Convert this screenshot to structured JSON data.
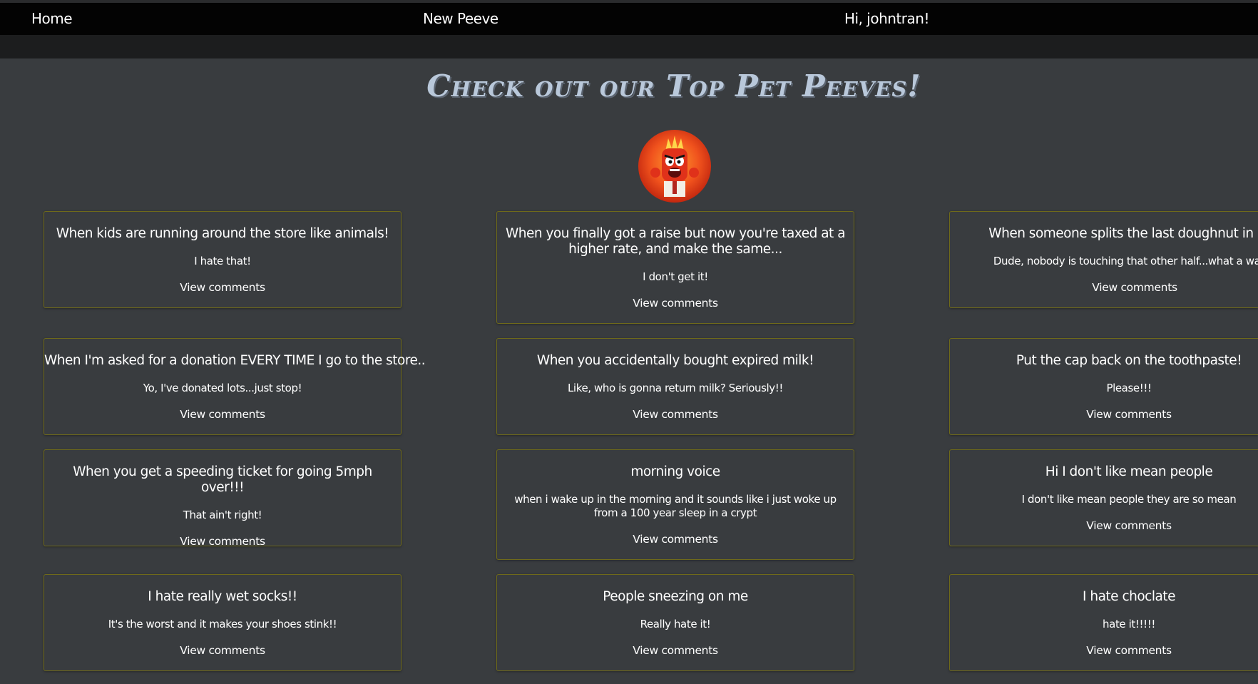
{
  "nav": {
    "home": "Home",
    "new_peeve": "New Peeve",
    "greeting": "Hi, johntran!"
  },
  "headline": "Check out our Top Pet Peeves!",
  "avatar_icon": "angry-character-icon",
  "accent_color": "#6f6a1a",
  "view_comments_label": "View comments",
  "cards": [
    {
      "title": "When kids are running around the store like animals!",
      "body": "I hate that!",
      "link": "View comments"
    },
    {
      "title": "When you finally got a raise but now you're taxed at a higher rate, and make the same...",
      "body": "I don't get it!",
      "link": "View comments"
    },
    {
      "title": "When someone splits the last doughnut in half",
      "body": "Dude, nobody is touching that other half...what a waste",
      "link": "View comments"
    },
    {
      "title": "When I'm asked for a donation EVERY TIME I go to the store..",
      "body": "Yo, I've donated lots...just stop!",
      "link": "View comments"
    },
    {
      "title": "When you accidentally bought expired milk!",
      "body": "Like, who is gonna return milk? Seriously!!",
      "link": "View comments"
    },
    {
      "title": "Put the cap back on the toothpaste!",
      "body": "Please!!!",
      "link": "View comments"
    },
    {
      "title": "When you get a speeding ticket for going 5mph over!!!",
      "body": "That ain't right!",
      "link": "View comments"
    },
    {
      "title": "morning voice",
      "body": "when i wake up in the morning and it sounds like i just woke up from a 100 year sleep in a crypt",
      "link": "View comments"
    },
    {
      "title": "Hi I don't like mean people",
      "body": "I don't like mean people they are so mean",
      "link": "View comments"
    },
    {
      "title": "I hate really wet socks!!",
      "body": "It's the worst and it makes your shoes stink!!",
      "link": "View comments"
    },
    {
      "title": "People sneezing on me",
      "body": "Really hate it!",
      "link": "View comments"
    },
    {
      "title": "I hate choclate",
      "body": "hate it!!!!!",
      "link": "View comments"
    }
  ]
}
